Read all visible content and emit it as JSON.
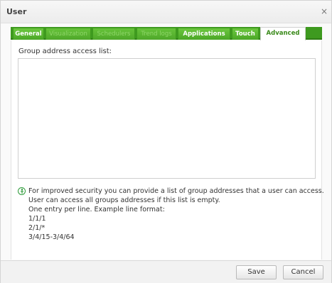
{
  "dialog": {
    "title": "User",
    "close_glyph": "×"
  },
  "tabs": [
    {
      "label": "General",
      "state": "enabled"
    },
    {
      "label": "Visualization",
      "state": "disabled"
    },
    {
      "label": "Schedulers",
      "state": "disabled"
    },
    {
      "label": "Trend logs",
      "state": "disabled"
    },
    {
      "label": "Applications",
      "state": "enabled"
    },
    {
      "label": "Touch",
      "state": "enabled"
    },
    {
      "label": "Advanced",
      "state": "active"
    }
  ],
  "panel": {
    "field_label": "Group address access list:",
    "textarea_value": "",
    "help_icon": "info-icon",
    "help_lines": [
      "For improved security you can provide a list of group addresses that a user can access.",
      "User can access all groups addresses if this list is empty.",
      "One entry per line. Example line format:",
      "1/1/1",
      "2/1/*",
      "3/4/15-3/4/64"
    ]
  },
  "footer": {
    "save_label": "Save",
    "cancel_label": "Cancel"
  },
  "colors": {
    "tab_green": "#4aa726",
    "tab_active_text": "#3a8a1a",
    "help_icon": "#2e9b3a"
  }
}
